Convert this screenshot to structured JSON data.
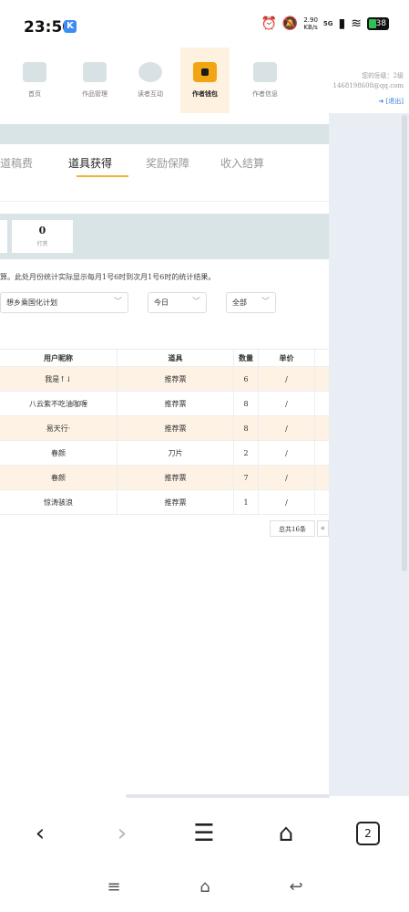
{
  "status_bar": {
    "time": "23:50",
    "app_badge": "K",
    "net_speed": "2.90",
    "net_unit": "KB/s",
    "network": "5G",
    "battery": "38"
  },
  "top_nav": {
    "items": [
      {
        "label": "首页"
      },
      {
        "label": "作品管理"
      },
      {
        "label": "读者互动"
      },
      {
        "label": "作者钱包"
      },
      {
        "label": "作者信息"
      }
    ],
    "user": {
      "level": "您的등级：2级",
      "email": "1468198608@qq.com",
      "logout": "[退出]"
    }
  },
  "tabs": [
    {
      "label": "道稿费"
    },
    {
      "label": "道具获得"
    },
    {
      "label": "奖励保障"
    },
    {
      "label": "收入结算"
    }
  ],
  "stat": {
    "value": "0",
    "label": "打赏"
  },
  "notice": "算。此处月份统计实际显示每月1号6时到次月1号6时的统计结果。",
  "filters": {
    "book": "想乡乘国化计划",
    "date": "今日",
    "type": "全部"
  },
  "table": {
    "headers": [
      "用户昵称",
      "道具",
      "数量",
      "单价"
    ],
    "rows": [
      {
        "user": "我是↑↓",
        "item": "推荐票",
        "qty": "6",
        "price": "/"
      },
      {
        "user": "八云紫不吃油咖喱",
        "item": "推荐票",
        "qty": "8",
        "price": "/"
      },
      {
        "user": "易天行·",
        "item": "推荐票",
        "qty": "8",
        "price": "/"
      },
      {
        "user": "春颜",
        "item": "刀片",
        "qty": "2",
        "price": "/"
      },
      {
        "user": "春颜",
        "item": "推荐票",
        "qty": "7",
        "price": "/"
      },
      {
        "user": "惊涛骇浪",
        "item": "推荐票",
        "qty": "1",
        "price": "/"
      }
    ]
  },
  "pagination": {
    "total": "总共16条",
    "prev": "«"
  },
  "browser": {
    "tab_count": "2"
  }
}
